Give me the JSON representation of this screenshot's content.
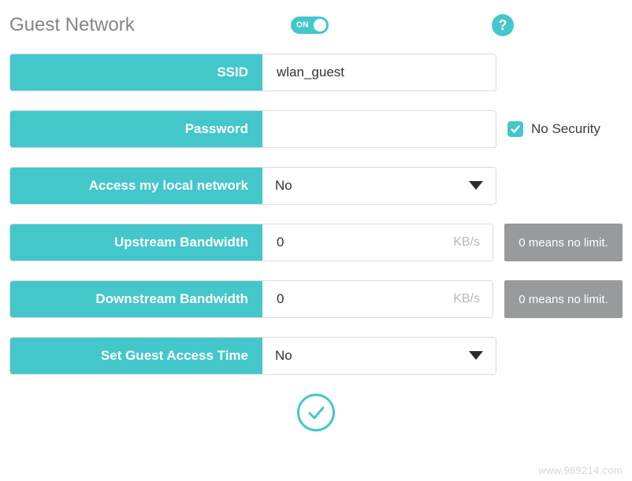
{
  "header": {
    "title": "Guest Network",
    "toggle_label": "ON",
    "help_icon_glyph": "?"
  },
  "fields": {
    "ssid": {
      "label": "SSID",
      "value": "wlan_guest"
    },
    "password": {
      "label": "Password",
      "value": ""
    },
    "no_security": {
      "label": "No Security",
      "checked": true
    },
    "local_access": {
      "label": "Access my local network",
      "value": "No"
    },
    "upstream": {
      "label": "Upstream Bandwidth",
      "value": "0",
      "unit": "KB/s",
      "hint": "0 means no limit."
    },
    "downstream": {
      "label": "Downstream Bandwidth",
      "value": "0",
      "unit": "KB/s",
      "hint": "0 means no limit."
    },
    "guest_time": {
      "label": "Set Guest Access Time",
      "value": "No"
    }
  },
  "watermark": "www.989214.com"
}
